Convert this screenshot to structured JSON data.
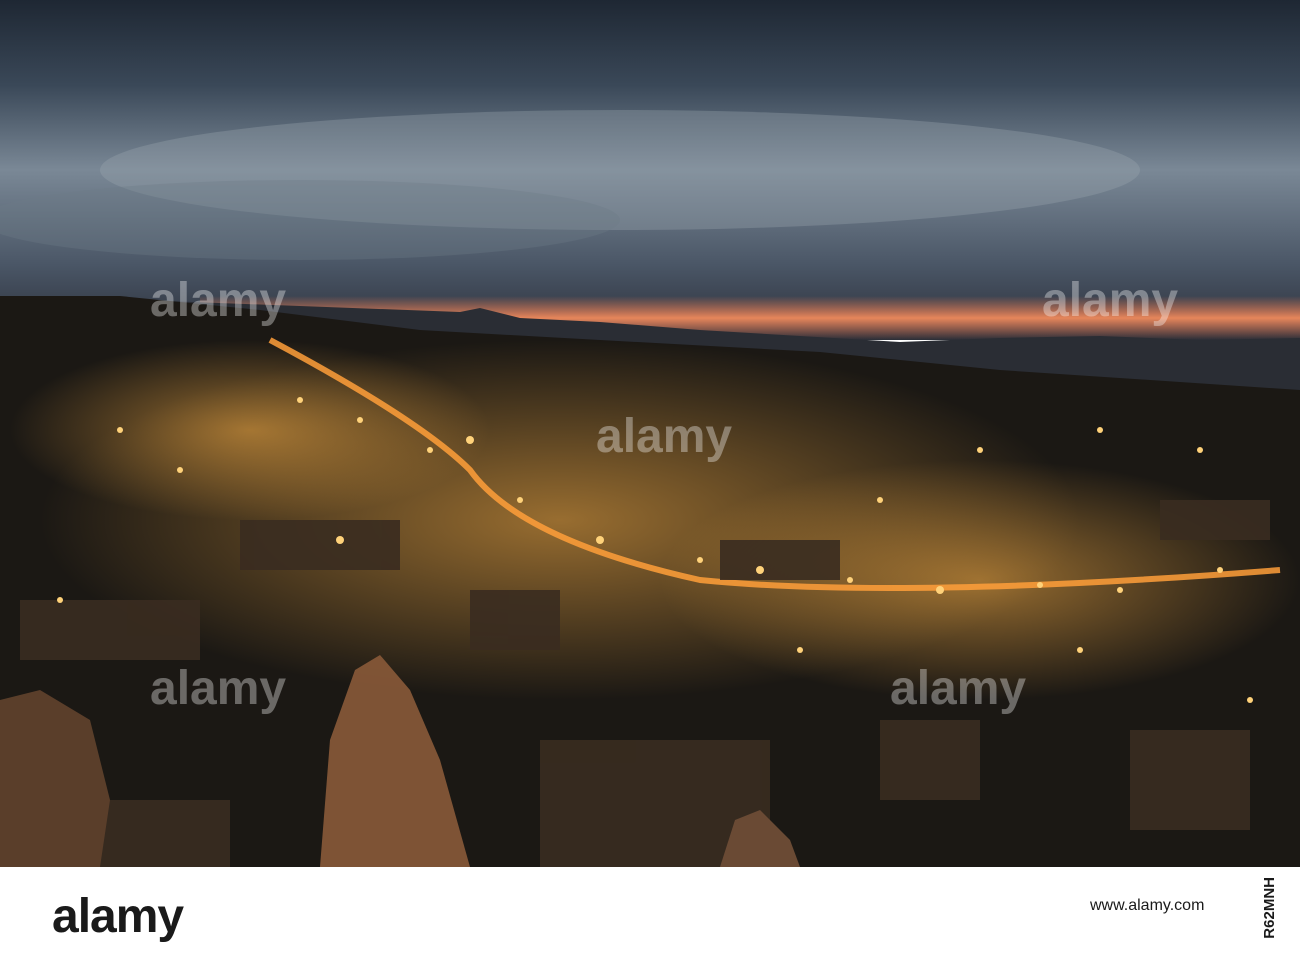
{
  "photo": {
    "sky_colors": [
      "#2b3644",
      "#5b6a78",
      "#8a96a0"
    ],
    "sunset_glow": "#f07a52",
    "town_light": "#ffb347"
  },
  "watermark": {
    "text": "alamy"
  },
  "footer": {
    "logo": "alamy",
    "image_id": "R62MNH",
    "url": "www.alamy.com"
  }
}
